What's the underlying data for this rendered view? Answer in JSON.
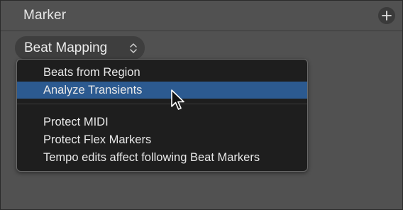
{
  "panel": {
    "title": "Marker",
    "add_icon": "plus-icon"
  },
  "popup": {
    "selected": "Beat Mapping",
    "icon": "up-down-chevrons-icon"
  },
  "menu": {
    "items": [
      {
        "label": "Beats from Region",
        "highlighted": false
      },
      {
        "label": "Analyze Transients",
        "highlighted": true
      },
      {
        "label": "Protect MIDI",
        "highlighted": false
      },
      {
        "label": "Protect Flex Markers",
        "highlighted": false
      },
      {
        "label": "Tempo edits affect following Beat Markers",
        "highlighted": false
      }
    ],
    "highlight_color": "#2c5a90"
  },
  "cursor": {
    "icon": "arrow-cursor-icon"
  }
}
